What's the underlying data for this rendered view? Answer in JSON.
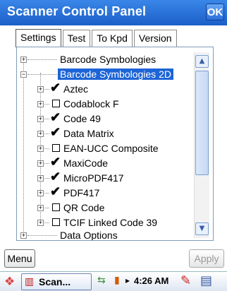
{
  "window": {
    "title": "Scanner Control Panel",
    "ok_label": "OK"
  },
  "tabs": [
    {
      "label": "Settings",
      "active": true
    },
    {
      "label": "Test",
      "active": false
    },
    {
      "label": "To Kpd",
      "active": false
    },
    {
      "label": "Version",
      "active": false
    }
  ],
  "tree": {
    "items": [
      {
        "label": "Barcode Symbologies",
        "level": 0,
        "expander": "+"
      },
      {
        "label": "Barcode Symbologies 2D",
        "level": 0,
        "expander": "−",
        "selected": true
      },
      {
        "label": "Aztec",
        "level": 1,
        "expander": "+",
        "checked": true
      },
      {
        "label": "Codablock F",
        "level": 1,
        "expander": "+",
        "checked": false
      },
      {
        "label": "Code 49",
        "level": 1,
        "expander": "+",
        "checked": true
      },
      {
        "label": "Data Matrix",
        "level": 1,
        "expander": "+",
        "checked": true
      },
      {
        "label": "EAN-UCC Composite",
        "level": 1,
        "expander": "+",
        "checked": false
      },
      {
        "label": "MaxiCode",
        "level": 1,
        "expander": "+",
        "checked": true
      },
      {
        "label": "MicroPDF417",
        "level": 1,
        "expander": "+",
        "checked": true
      },
      {
        "label": "PDF417",
        "level": 1,
        "expander": "+",
        "checked": true
      },
      {
        "label": "QR Code",
        "level": 1,
        "expander": "+",
        "checked": false
      },
      {
        "label": "TCIF Linked Code 39",
        "level": 1,
        "expander": "+",
        "checked": false
      },
      {
        "label": "Data Options",
        "level": 0,
        "expander": "+"
      }
    ],
    "scroll_up_icon": "▲",
    "scroll_down_icon": "▼"
  },
  "buttons": {
    "menu_label": "Menu",
    "apply_label": "Apply"
  },
  "taskbar": {
    "start_icon": "windows-flag-icon",
    "task_label": "Scan...",
    "clock": "4:26 AM"
  }
}
